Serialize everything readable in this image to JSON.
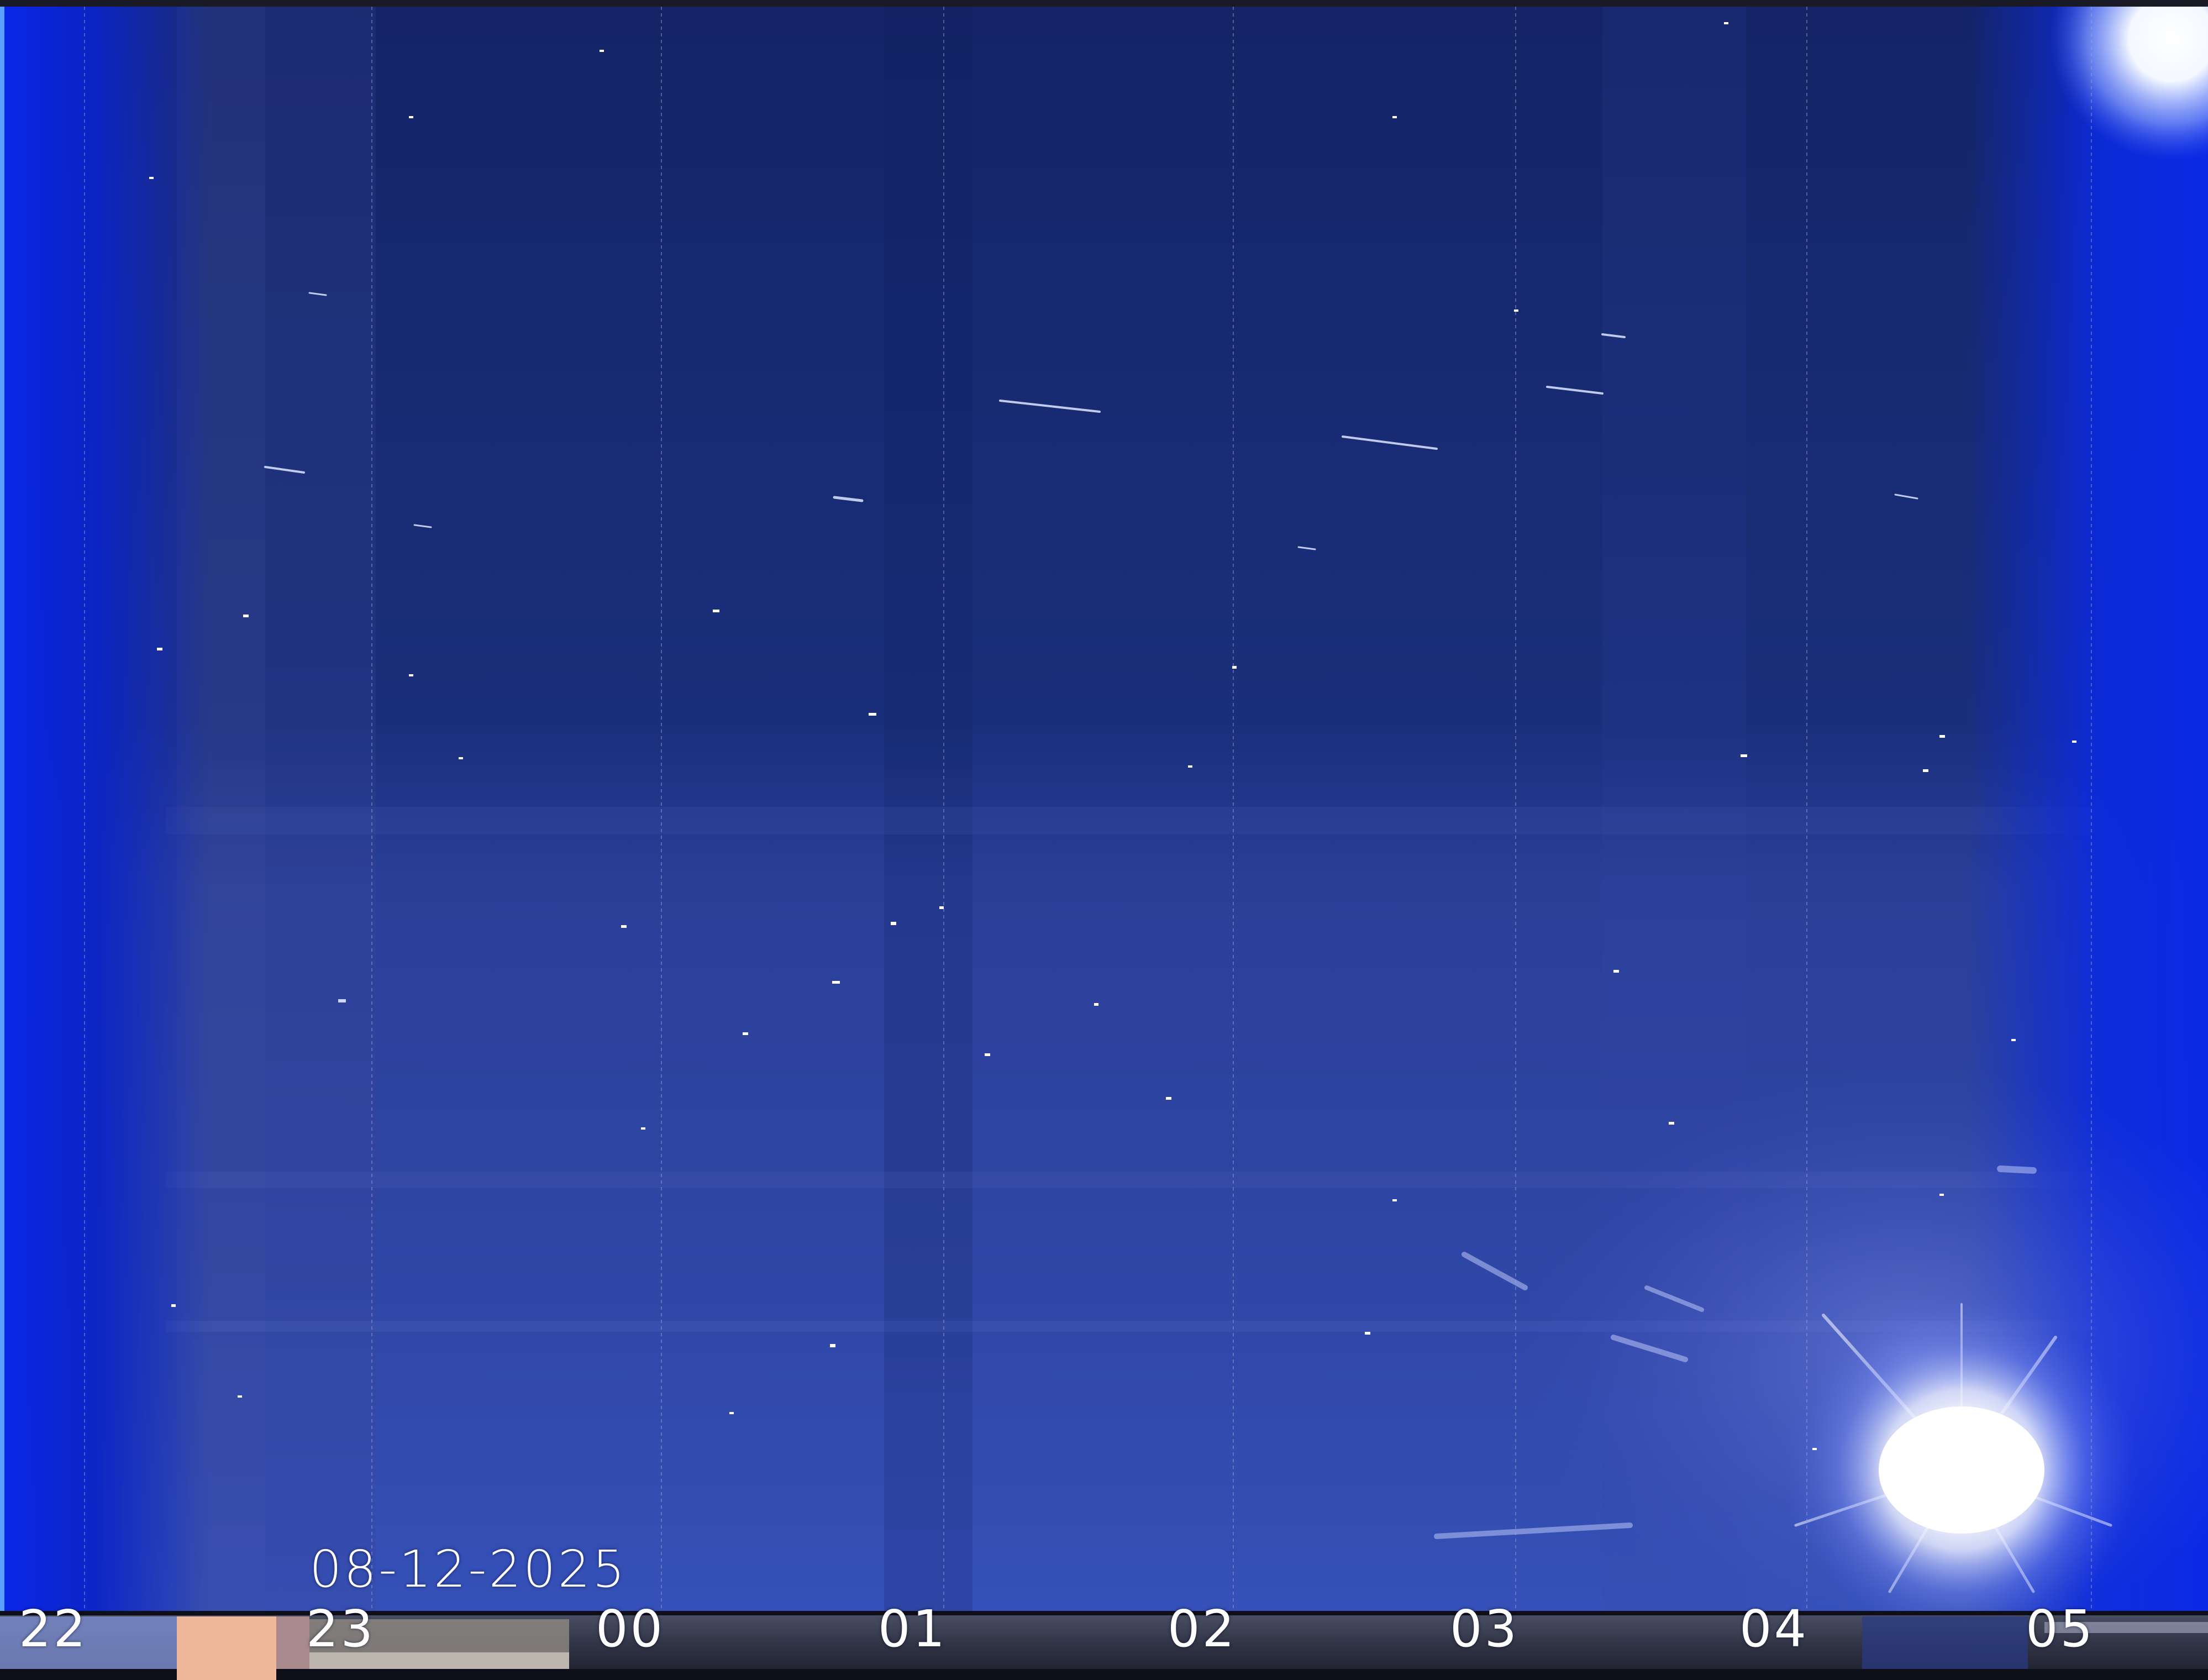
{
  "overlay": {
    "date": "08-12-2025",
    "hours": [
      "22",
      "23",
      "00",
      "01",
      "02",
      "03",
      "04",
      "05"
    ]
  },
  "colors": {
    "sky_deep": "#14286e",
    "sky_mid": "#2a3f9a",
    "sky_edge": "#0a28e6",
    "sun_glow": "#ffffff",
    "strip_dark": "#2a2e3e",
    "strip_peach": "#f0b89a",
    "text": "#ffffff"
  }
}
